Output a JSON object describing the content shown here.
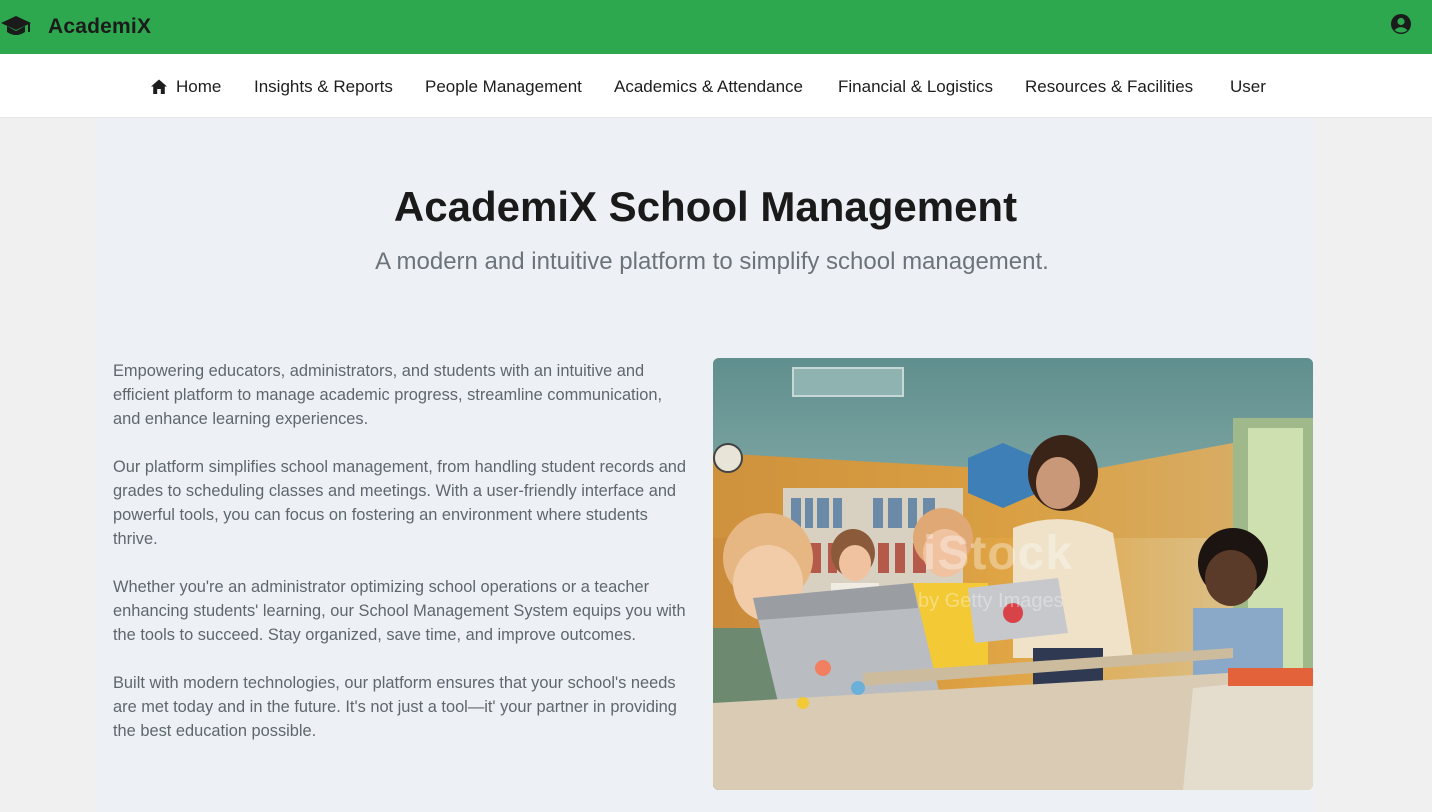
{
  "app": {
    "brand_name": "AcademiX",
    "brand_icon": "graduation-cap-icon",
    "account_icon": "account-circle-icon",
    "header_color": "#2ea84e"
  },
  "nav": {
    "home_icon": "home-icon",
    "items": [
      "Home",
      "Insights & Reports",
      "People Management",
      "Academics & Attendance",
      "Financial & Logistics",
      "Resources & Facilities",
      "User"
    ]
  },
  "hero": {
    "title": "AcademiX School Management",
    "subtitle": "A modern and intuitive platform to simplify school management."
  },
  "content": {
    "paragraphs": [
      "Empowering educators, administrators, and students with an intuitive and efficient platform to manage academic progress, streamline communication, and enhance learning experiences.",
      "Our platform simplifies school management, from handling student records and grades to scheduling classes and meetings. With a user-friendly interface and powerful tools, you can focus on fostering an environment where students thrive.",
      "Whether you're an administrator optimizing school operations or a teacher enhancing students' learning, our School Management System equips you with the tools to succeed. Stay organized, save time, and improve outcomes.",
      "Built with modern technologies, our platform ensures that your school's needs are met today and in the future. It's not just a tool—it' your partner in providing the best education possible."
    ],
    "image_watermark": "iStock",
    "image_watermark_sub": "by Getty Images"
  }
}
